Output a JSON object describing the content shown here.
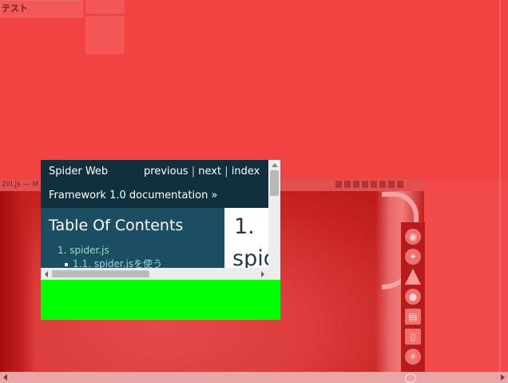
{
  "top_tab": {
    "label": "テスト"
  },
  "background_window": {
    "title": "2III.js —  M"
  },
  "popup": {
    "brand_line1": "Spider Web",
    "brand_line2": "Framework 1.0 documentation »",
    "nav": {
      "previous": "previous",
      "next": "next",
      "index": "index",
      "separator": " | "
    },
    "toc": {
      "title": "Table Of Contents",
      "items": [
        {
          "label": "1. spider.js"
        },
        {
          "label": "1.1. spider.jsを使う"
        }
      ]
    },
    "body": {
      "heading_line1": "1.",
      "heading_line2": "spid"
    }
  },
  "colors": {
    "overlay_red": "#f24343",
    "doc_header": "#11303d",
    "doc_sidebar": "#1c4e63",
    "toc_link": "#98dbcc",
    "green_area": "#00ff00"
  },
  "icons": {
    "dock": [
      "browser-icon",
      "chat-icon",
      "vlc-cone-icon",
      "disc-icon",
      "trash-icon",
      "document-icon",
      "settings-sun-icon"
    ]
  }
}
